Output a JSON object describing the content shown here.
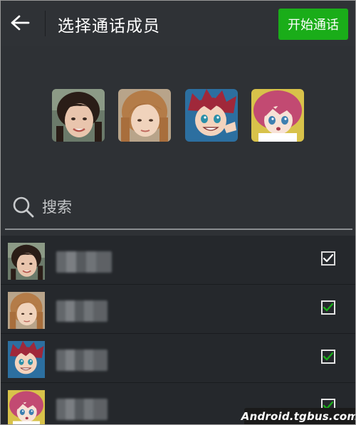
{
  "header": {
    "title": "选择通话成员",
    "start_button": "开始通话"
  },
  "selected_members": [
    {
      "avatar": "girl-photo-1"
    },
    {
      "avatar": "girl-photo-2"
    },
    {
      "avatar": "anime-boy-red-hair"
    },
    {
      "avatar": "anime-girl-pink-hair"
    }
  ],
  "search": {
    "placeholder": "搜索"
  },
  "contacts": [
    {
      "avatar": "girl-photo-1",
      "name_blurred": true,
      "checked": true,
      "check_color": "#ffffff"
    },
    {
      "avatar": "girl-photo-2",
      "name_blurred": true,
      "checked": true,
      "check_color": "#1aad19"
    },
    {
      "avatar": "anime-boy-red-hair",
      "name_blurred": true,
      "checked": true,
      "check_color": "#1aad19"
    },
    {
      "avatar": "anime-girl-pink-hair",
      "name_blurred": true,
      "checked": true,
      "check_color": "#1aad19"
    }
  ],
  "colors": {
    "accent": "#1aad19",
    "background": "#2e3135",
    "list_background": "#25282c"
  },
  "watermark": "Android.tgbus.com"
}
